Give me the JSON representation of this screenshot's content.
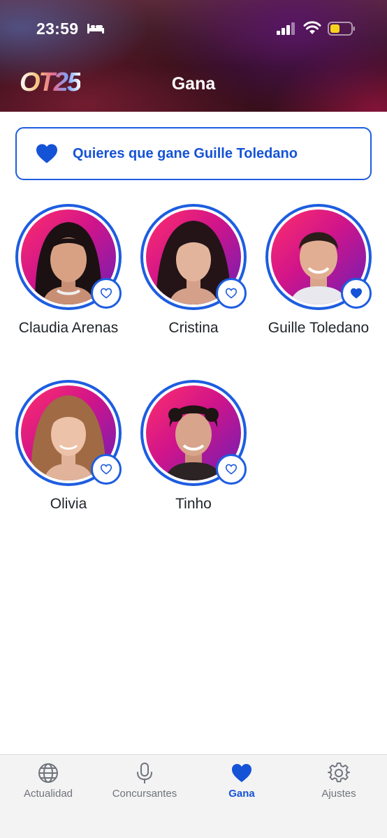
{
  "status_bar": {
    "time": "23:59",
    "icons": [
      "bed-icon",
      "cellular-signal-icon",
      "wifi-icon",
      "battery-icon"
    ]
  },
  "header": {
    "logo_text": "OT25",
    "title": "Gana"
  },
  "banner": {
    "icon": "heart-icon",
    "text": "Quieres que gane Guille Toledano"
  },
  "contestants": [
    {
      "name": "Claudia Arenas",
      "favorite": false
    },
    {
      "name": "Cristina",
      "favorite": false
    },
    {
      "name": "Guille Toledano",
      "favorite": true
    },
    {
      "name": "Olivia",
      "favorite": false
    },
    {
      "name": "Tinho",
      "favorite": false
    }
  ],
  "tabbar": {
    "tabs": [
      {
        "label": "Actualidad",
        "icon": "globe-icon",
        "active": false
      },
      {
        "label": "Concursantes",
        "icon": "microphone-icon",
        "active": false
      },
      {
        "label": "Gana",
        "icon": "heart-icon",
        "active": true
      },
      {
        "label": "Ajustes",
        "icon": "gear-icon",
        "active": false
      }
    ]
  },
  "colors": {
    "accent": "#1d5de0",
    "accent_text": "#1553d6",
    "inactive_tab": "#6f737b",
    "avatar_gradient_start": "#ff2f6c",
    "avatar_gradient_end": "#6c1fb5"
  }
}
